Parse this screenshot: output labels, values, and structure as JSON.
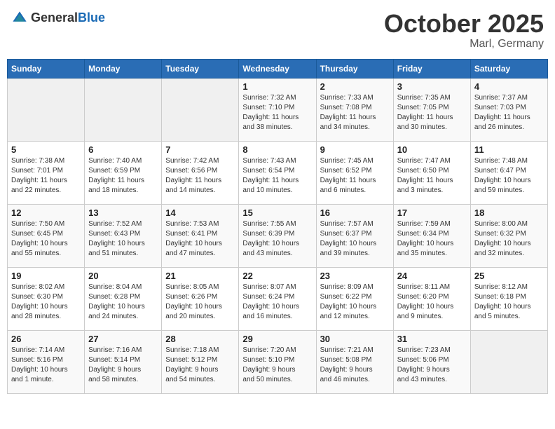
{
  "header": {
    "logo_general": "General",
    "logo_blue": "Blue",
    "month": "October 2025",
    "location": "Marl, Germany"
  },
  "days_of_week": [
    "Sunday",
    "Monday",
    "Tuesday",
    "Wednesday",
    "Thursday",
    "Friday",
    "Saturday"
  ],
  "weeks": [
    [
      {
        "day": "",
        "info": ""
      },
      {
        "day": "",
        "info": ""
      },
      {
        "day": "",
        "info": ""
      },
      {
        "day": "1",
        "info": "Sunrise: 7:32 AM\nSunset: 7:10 PM\nDaylight: 11 hours\nand 38 minutes."
      },
      {
        "day": "2",
        "info": "Sunrise: 7:33 AM\nSunset: 7:08 PM\nDaylight: 11 hours\nand 34 minutes."
      },
      {
        "day": "3",
        "info": "Sunrise: 7:35 AM\nSunset: 7:05 PM\nDaylight: 11 hours\nand 30 minutes."
      },
      {
        "day": "4",
        "info": "Sunrise: 7:37 AM\nSunset: 7:03 PM\nDaylight: 11 hours\nand 26 minutes."
      }
    ],
    [
      {
        "day": "5",
        "info": "Sunrise: 7:38 AM\nSunset: 7:01 PM\nDaylight: 11 hours\nand 22 minutes."
      },
      {
        "day": "6",
        "info": "Sunrise: 7:40 AM\nSunset: 6:59 PM\nDaylight: 11 hours\nand 18 minutes."
      },
      {
        "day": "7",
        "info": "Sunrise: 7:42 AM\nSunset: 6:56 PM\nDaylight: 11 hours\nand 14 minutes."
      },
      {
        "day": "8",
        "info": "Sunrise: 7:43 AM\nSunset: 6:54 PM\nDaylight: 11 hours\nand 10 minutes."
      },
      {
        "day": "9",
        "info": "Sunrise: 7:45 AM\nSunset: 6:52 PM\nDaylight: 11 hours\nand 6 minutes."
      },
      {
        "day": "10",
        "info": "Sunrise: 7:47 AM\nSunset: 6:50 PM\nDaylight: 11 hours\nand 3 minutes."
      },
      {
        "day": "11",
        "info": "Sunrise: 7:48 AM\nSunset: 6:47 PM\nDaylight: 10 hours\nand 59 minutes."
      }
    ],
    [
      {
        "day": "12",
        "info": "Sunrise: 7:50 AM\nSunset: 6:45 PM\nDaylight: 10 hours\nand 55 minutes."
      },
      {
        "day": "13",
        "info": "Sunrise: 7:52 AM\nSunset: 6:43 PM\nDaylight: 10 hours\nand 51 minutes."
      },
      {
        "day": "14",
        "info": "Sunrise: 7:53 AM\nSunset: 6:41 PM\nDaylight: 10 hours\nand 47 minutes."
      },
      {
        "day": "15",
        "info": "Sunrise: 7:55 AM\nSunset: 6:39 PM\nDaylight: 10 hours\nand 43 minutes."
      },
      {
        "day": "16",
        "info": "Sunrise: 7:57 AM\nSunset: 6:37 PM\nDaylight: 10 hours\nand 39 minutes."
      },
      {
        "day": "17",
        "info": "Sunrise: 7:59 AM\nSunset: 6:34 PM\nDaylight: 10 hours\nand 35 minutes."
      },
      {
        "day": "18",
        "info": "Sunrise: 8:00 AM\nSunset: 6:32 PM\nDaylight: 10 hours\nand 32 minutes."
      }
    ],
    [
      {
        "day": "19",
        "info": "Sunrise: 8:02 AM\nSunset: 6:30 PM\nDaylight: 10 hours\nand 28 minutes."
      },
      {
        "day": "20",
        "info": "Sunrise: 8:04 AM\nSunset: 6:28 PM\nDaylight: 10 hours\nand 24 minutes."
      },
      {
        "day": "21",
        "info": "Sunrise: 8:05 AM\nSunset: 6:26 PM\nDaylight: 10 hours\nand 20 minutes."
      },
      {
        "day": "22",
        "info": "Sunrise: 8:07 AM\nSunset: 6:24 PM\nDaylight: 10 hours\nand 16 minutes."
      },
      {
        "day": "23",
        "info": "Sunrise: 8:09 AM\nSunset: 6:22 PM\nDaylight: 10 hours\nand 12 minutes."
      },
      {
        "day": "24",
        "info": "Sunrise: 8:11 AM\nSunset: 6:20 PM\nDaylight: 10 hours\nand 9 minutes."
      },
      {
        "day": "25",
        "info": "Sunrise: 8:12 AM\nSunset: 6:18 PM\nDaylight: 10 hours\nand 5 minutes."
      }
    ],
    [
      {
        "day": "26",
        "info": "Sunrise: 7:14 AM\nSunset: 5:16 PM\nDaylight: 10 hours\nand 1 minute."
      },
      {
        "day": "27",
        "info": "Sunrise: 7:16 AM\nSunset: 5:14 PM\nDaylight: 9 hours\nand 58 minutes."
      },
      {
        "day": "28",
        "info": "Sunrise: 7:18 AM\nSunset: 5:12 PM\nDaylight: 9 hours\nand 54 minutes."
      },
      {
        "day": "29",
        "info": "Sunrise: 7:20 AM\nSunset: 5:10 PM\nDaylight: 9 hours\nand 50 minutes."
      },
      {
        "day": "30",
        "info": "Sunrise: 7:21 AM\nSunset: 5:08 PM\nDaylight: 9 hours\nand 46 minutes."
      },
      {
        "day": "31",
        "info": "Sunrise: 7:23 AM\nSunset: 5:06 PM\nDaylight: 9 hours\nand 43 minutes."
      },
      {
        "day": "",
        "info": ""
      }
    ]
  ]
}
